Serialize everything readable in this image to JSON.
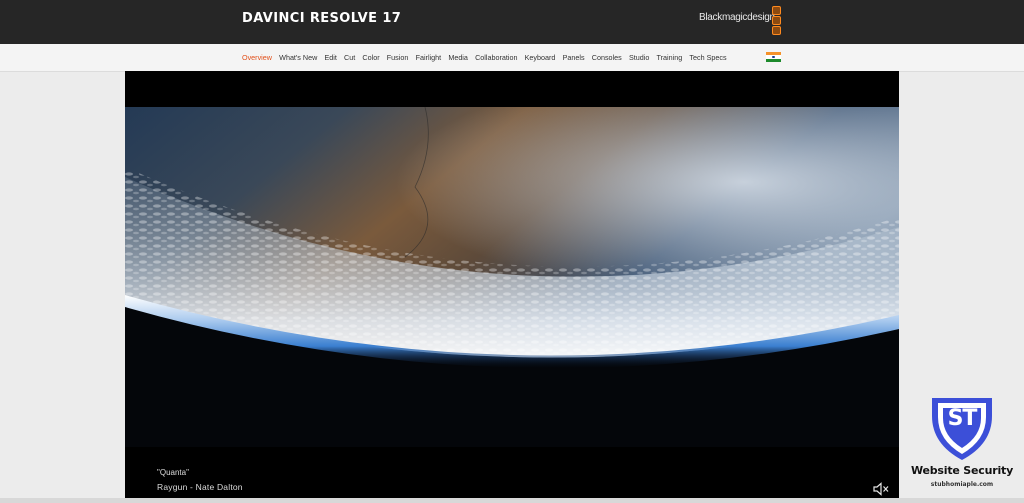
{
  "header": {
    "product_title": "DAVINCI RESOLVE 17",
    "brand_text": "Blackmagicdesign",
    "brand_color": "#ff8a1f"
  },
  "subnav": {
    "items": [
      {
        "label": "Overview",
        "active": true
      },
      {
        "label": "What's New",
        "active": false
      },
      {
        "label": "Edit",
        "active": false
      },
      {
        "label": "Cut",
        "active": false
      },
      {
        "label": "Color",
        "active": false
      },
      {
        "label": "Fusion",
        "active": false
      },
      {
        "label": "Fairlight",
        "active": false
      },
      {
        "label": "Media",
        "active": false
      },
      {
        "label": "Collaboration",
        "active": false
      },
      {
        "label": "Keyboard",
        "active": false
      },
      {
        "label": "Panels",
        "active": false
      },
      {
        "label": "Consoles",
        "active": false
      },
      {
        "label": "Studio",
        "active": false
      },
      {
        "label": "Training",
        "active": false
      },
      {
        "label": "Tech Specs",
        "active": false
      }
    ],
    "active_color": "#e2501a",
    "region_flag": "india-flag-icon"
  },
  "video": {
    "caption_title": "\"Quanta\"",
    "caption_credit": "Raygun - Nate Dalton",
    "mute_icon": "speaker-muted-icon"
  },
  "badge": {
    "logo_text": "ST",
    "title": "Website Security",
    "url": "stubhomiaple.com",
    "logo_color": "#3c4fd8"
  }
}
